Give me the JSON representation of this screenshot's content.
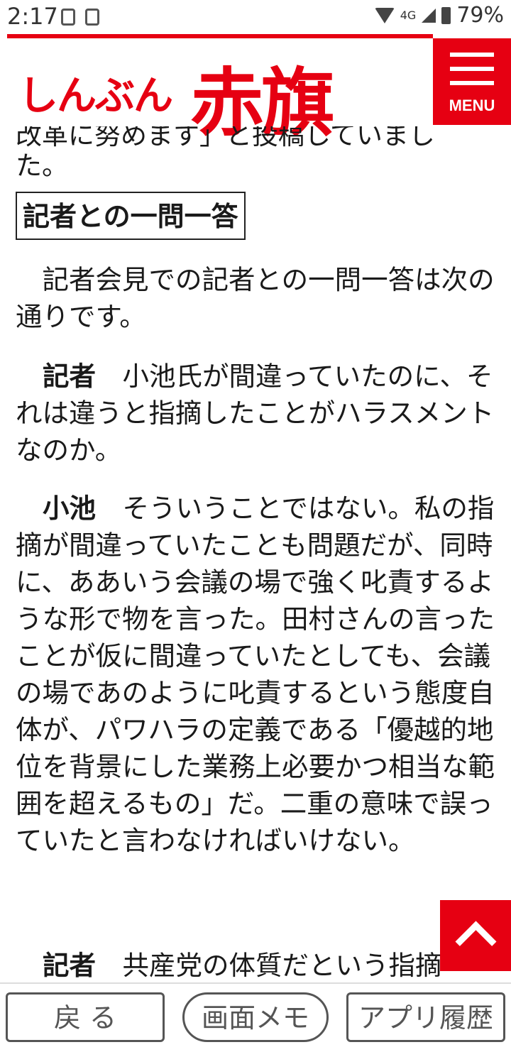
{
  "status": {
    "time": "2:17",
    "network": "4G",
    "battery": "79%"
  },
  "header": {
    "logo_small": "しんぶん",
    "logo_big": "赤旗",
    "menu_label": "MENU",
    "brand_color": "#e60012"
  },
  "article": {
    "cut_line": "改革に努めます」と投稿していまし",
    "cut_line_tail": "た。",
    "heading": "記者との一問一答",
    "paragraphs": [
      {
        "speaker": "",
        "text": "　記者会見での記者との一問一答は次の通りです。"
      },
      {
        "speaker": "記者",
        "text": "　小池氏が間違っていたのに、それは違うと指摘したことがハラスメントなのか。"
      },
      {
        "speaker": "小池",
        "text": "　そういうことではない。私の指摘が間違っていたことも問題だが、同時に、ああいう会議の場で強く叱責するような形で物を言った。田村さんの言ったことが仮に間違っていたとしても、会議の場であのように叱責するという態度自体が、パワハラの定義である「優越的地位を背景にした業務上必要かつ相当な範囲を超えるもの」だ。二重の意味で誤っていたと言わなければいけない。"
      },
      {
        "speaker": "記者",
        "text": "　共産党の体質だという指摘"
      }
    ]
  },
  "bottom_bar": {
    "back": "戻 る",
    "memo": "画面メモ",
    "history": "アプリ履歴"
  },
  "icons": {
    "scroll_top": "chevron-up-icon",
    "menu": "hamburger-icon"
  }
}
